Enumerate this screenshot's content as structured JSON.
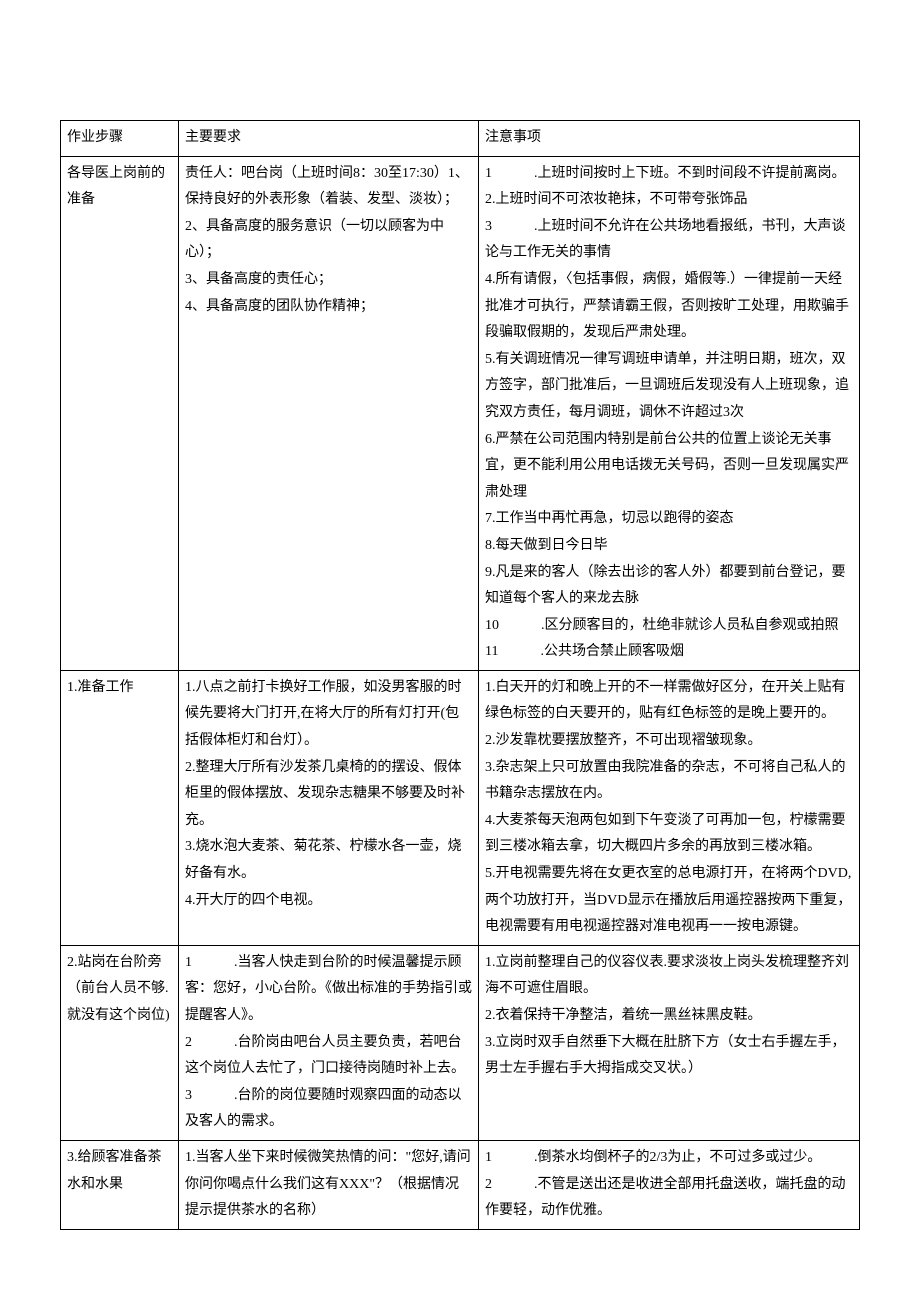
{
  "headers": {
    "col1": "作业步骤",
    "col2": "主要要求",
    "col3": "注意事项"
  },
  "rows": [
    {
      "step": "各导医上岗前的准备",
      "req": "责任人：吧台岗（上班时间8：30至17:30）1、保持良好的外表形象（着装、发型、淡妆）；\n2、具备高度的服务意识（一切以顾客为中心）；\n3、具备高度的责任心；\n4、具备高度的团队协作精神；",
      "note": "1　　　.上班时间按时上下班。不到时间段不许提前离岗。\n2.上班时间不可浓妆艳抹，不可带夸张饰品\n3　　　.上班时间不允许在公共场地看报纸，书刊，大声谈论与工作无关的事情\n4.所有请假，〈包括事假，病假，婚假等.）一律提前一天经批准才可执行，严禁请霸王假，否则按旷工处理，用欺骗手段骗取假期的，发现后严肃处理。\n5.有关调班情况一律写调班申请单，并注明日期，班次，双方签字，部门批准后，一旦调班后发现没有人上班现象，追究双方责任，每月调班，调休不许超过3次\n6.严禁在公司范围内特别是前台公共的位置上谈论无关事宜，更不能利用公用电话拨无关号码，否则一旦发现属实严肃处理\n7.工作当中再忙再急，切忌以跑得的姿态\n8.每天做到日今日毕\n9.凡是来的客人（除去出诊的客人外）都要到前台登记，要知道每个客人的来龙去脉\n10　　　.区分顾客目的，杜绝非就诊人员私自参观或拍照\n11　　　.公共场合禁止顾客吸烟"
    },
    {
      "step": "1.准备工作",
      "req": "1.八点之前打卡换好工作服，如没男客服的时候先要将大门打开,在将大厅的所有灯打开(包括假体柜灯和台灯）。\n2.整理大厅所有沙发茶几桌椅的的摆设、假体柜里的假体摆放、发现杂志糖果不够要及时补充。\n3.烧水泡大麦茶、菊花茶、柠檬水各一壶，烧好备有水。\n4.开大厅的四个电视。",
      "note": "1.白天开的灯和晚上开的不一样需做好区分，在开关上贴有绿色标签的白天要开的，贴有红色标签的是晚上要开的。\n2.沙发靠枕要摆放整齐，不可出现褶皱现象。\n3.杂志架上只可放置由我院准备的杂志，不可将自己私人的书籍杂志摆放在内。\n4.大麦茶每天泡两包如到下午变淡了可再加一包，柠檬需要到三楼冰箱去拿，切大概四片多余的再放到三楼冰箱。\n5.开电视需要先将在女更衣室的总电源打开，在将两个DVD,两个功放打开，当DVD显示在播放后用遥控器按两下重复，电视需要有用电视遥控器对准电视再一一按电源键。"
    },
    {
      "step": "2.站岗在台阶旁（前台人员不够.就没有这个岗位)",
      "req": "1　　　.当客人快走到台阶的时候温馨提示顾客：您好，小心台阶。《做出标准的手势指引或提醒客人》。\n2　　　.台阶岗由吧台人员主要负责，若吧台这个岗位人去忙了，门口接待岗随时补上去。\n3　　　.台阶的岗位要随时观察四面的动态以及客人的需求。",
      "note": "1.立岗前整理自己的仪容仪表.要求淡妆上岗头发梳理整齐刘海不可遮住眉眼。\n2.衣着保持干净整洁，着统一黑丝袜黑皮鞋。\n3.立岗时双手自然垂下大概在肚脐下方（女士右手握左手，男士左手握右手大拇指成交叉状。）"
    },
    {
      "step": "3.给顾客准备茶水和水果",
      "req": "1.当客人坐下来时候微笑热情的问：\"您好,请问你问你喝点什么我们这有XXX\"？（根据情况提示提供茶水的名称）",
      "note": "1　　　.倒茶水均倒杯子的2/3为止，不可过多或过少。\n2　　　.不管是送出还是收进全部用托盘送收，端托盘的动作要轻，动作优雅。"
    }
  ]
}
